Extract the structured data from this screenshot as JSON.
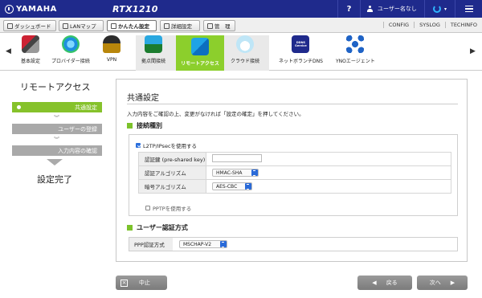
{
  "header": {
    "brand": "YAMAHA",
    "model": "RTX1210",
    "help": "?",
    "user_label": "ユーザー名なし",
    "status_caret": "▾"
  },
  "tabs": [
    {
      "label": "ダッシュボード"
    },
    {
      "label": "LANマップ"
    },
    {
      "label": "かんたん設定"
    },
    {
      "label": "詳細設定"
    },
    {
      "label": "管　理"
    }
  ],
  "right_links": [
    "CONFIG",
    "SYSLOG",
    "TECHINFO"
  ],
  "icon_strip": {
    "prev": "◀",
    "next": "▶",
    "items": [
      {
        "label": "基本設定"
      },
      {
        "label": "プロバイダー接続"
      },
      {
        "label": "VPN"
      },
      {
        "label": "拠点間接続"
      },
      {
        "label": "リモートアクセス"
      },
      {
        "label": "クラウド接続"
      },
      {
        "label": "ネットボランチDNS"
      },
      {
        "label": "YNOエージェント"
      }
    ],
    "dns_service_text": "DDNS Service"
  },
  "steps": {
    "title": "リモートアクセス",
    "items": [
      {
        "label": "共通設定"
      },
      {
        "label": "ユーザーの登録"
      },
      {
        "label": "入力内容の確認"
      }
    ],
    "done": "設定完了",
    "chevron": "︾"
  },
  "panel": {
    "title": "共通設定",
    "description": "入力内容をご確認の上、変更がなければ「設定の確定」を押してください。",
    "section1": "接続種別",
    "l2tp_label": "L2TP/IPsecを使用する",
    "fields": [
      {
        "label": "認証鍵 (pre-shared key)",
        "value": ""
      },
      {
        "label": "認証アルゴリズム",
        "value": "HMAC-SHA"
      },
      {
        "label": "暗号アルゴリズム",
        "value": "AES-CBC"
      }
    ],
    "pptp_label": "PPTPを使用する",
    "section2": "ユーザー認証方式",
    "ppp_label": "PPP認証方式",
    "ppp_value": "MSCHAP-V2"
  },
  "buttons": {
    "cancel": "中止",
    "back": "戻る",
    "next": "次へ",
    "back_arrow": "◀",
    "next_arrow": "▶"
  }
}
